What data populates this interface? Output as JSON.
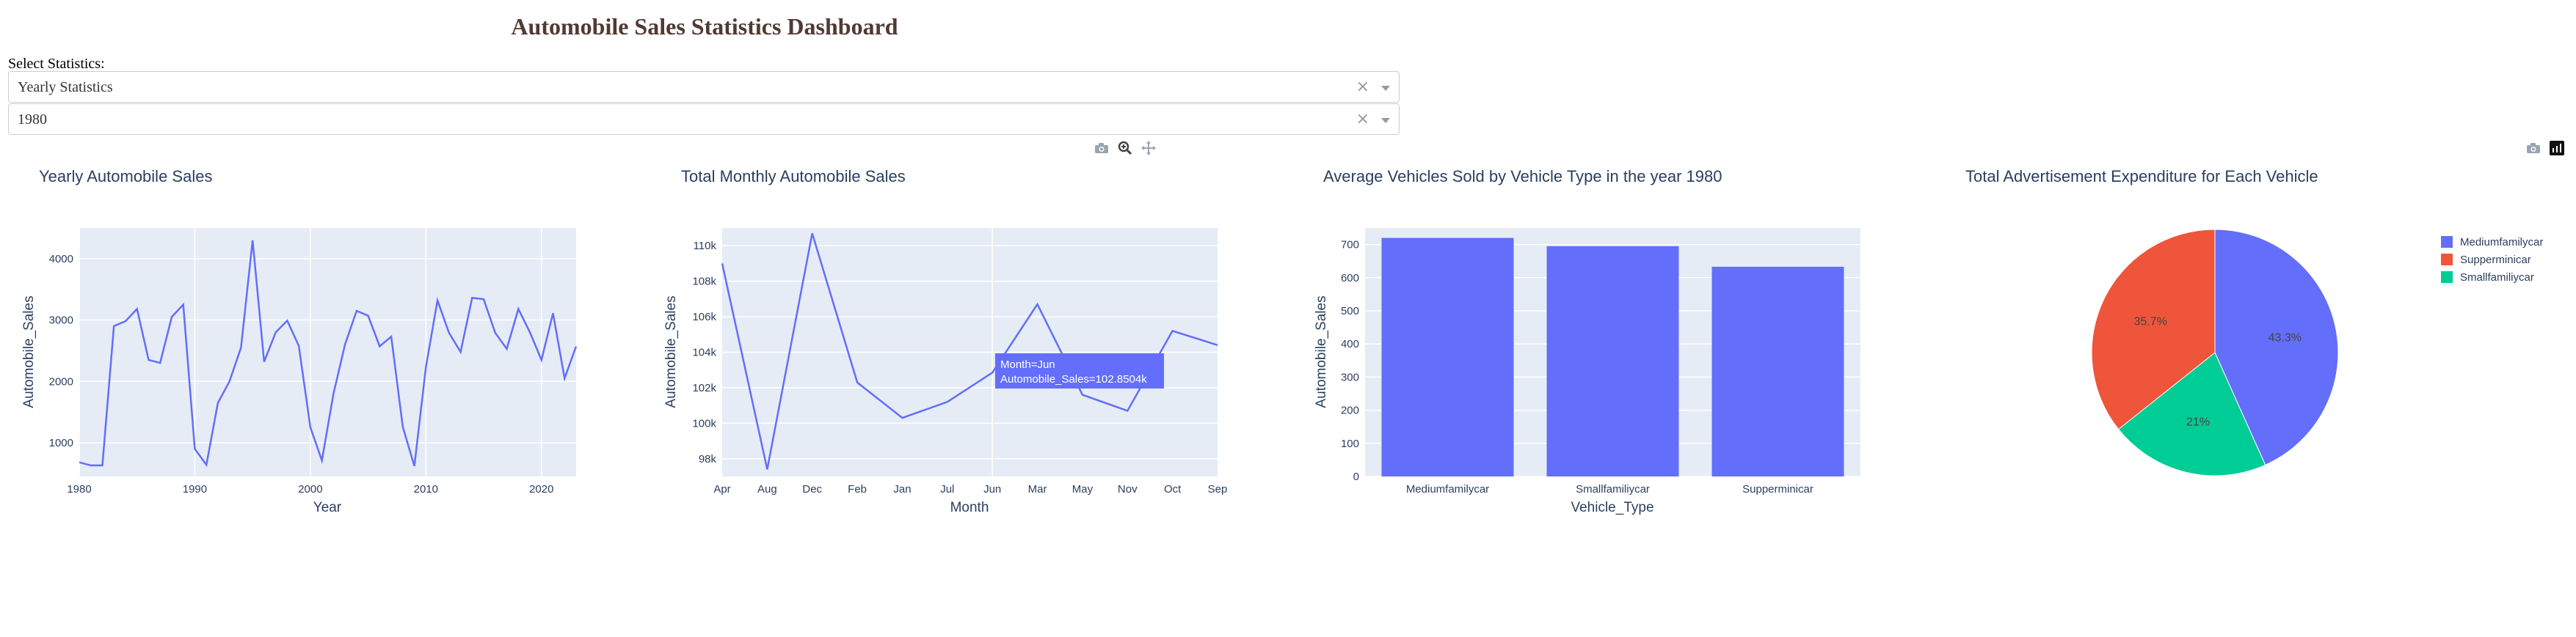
{
  "header": {
    "title": "Automobile Sales Statistics Dashboard"
  },
  "controls": {
    "label": "Select Statistics:",
    "dropdown1": {
      "value": "Yearly Statistics",
      "clear": "×"
    },
    "dropdown2": {
      "value": "1980",
      "clear": "×"
    }
  },
  "modebar1": [
    "camera-icon",
    "zoom-icon",
    "pan-icon"
  ],
  "modebar2": [
    "camera-icon",
    "plotly-logo-icon"
  ],
  "colors": {
    "series": "#636efa",
    "red": "#ef553b",
    "green": "#00cc96",
    "plot_bg": "#e5ecf6",
    "text": "#2a3f5f",
    "title": "#503a33"
  },
  "charts": [
    {
      "title": "Yearly Automobile Sales",
      "xlabel": "Year",
      "ylabel": "Automobile_Sales",
      "xticks": [
        "1980",
        "1990",
        "2000",
        "2010",
        "2020"
      ],
      "yticks": [
        "1000",
        "2000",
        "3000",
        "4000"
      ]
    },
    {
      "title": "Total Monthly Automobile Sales",
      "xlabel": "Month",
      "ylabel": "Automobile_Sales",
      "xticks": [
        "Apr",
        "Aug",
        "Dec",
        "Feb",
        "Jan",
        "Jul",
        "Jun",
        "Mar",
        "May",
        "Nov",
        "Oct",
        "Sep"
      ],
      "yticks": [
        "98k",
        "100k",
        "102k",
        "104k",
        "106k",
        "108k",
        "110k"
      ],
      "hover": {
        "line1": "Month=Jun",
        "line2": "Automobile_Sales=102.8504k"
      }
    },
    {
      "title": "Average Vehicles Sold by Vehicle Type in the year 1980",
      "xlabel": "Vehicle_Type",
      "ylabel": "Automobile_Sales",
      "xticks": [
        "Mediumfamilycar",
        "Smallfamiliycar",
        "Supperminicar"
      ],
      "yticks": [
        "0",
        "100",
        "200",
        "300",
        "400",
        "500",
        "600",
        "700"
      ]
    },
    {
      "title": "Total Advertisement Expenditure for Each Vehicle",
      "legend": [
        "Mediumfamilycar",
        "Supperminicar",
        "Smallfamiliycar"
      ],
      "labels": [
        "43.3%",
        "35.7%",
        "21%"
      ]
    }
  ],
  "chart_data": [
    {
      "type": "line",
      "x": [
        1980,
        1981,
        1982,
        1983,
        1984,
        1985,
        1986,
        1987,
        1988,
        1989,
        1990,
        1991,
        1992,
        1993,
        1994,
        1995,
        1996,
        1997,
        1998,
        1999,
        2000,
        2001,
        2002,
        2003,
        2004,
        2005,
        2006,
        2007,
        2008,
        2009,
        2010,
        2011,
        2012,
        2013,
        2014,
        2015,
        2016,
        2017,
        2018,
        2019,
        2020,
        2021,
        2022,
        2023
      ],
      "y": [
        680,
        630,
        630,
        2900,
        2980,
        3180,
        2350,
        2300,
        3050,
        3250,
        900,
        640,
        1650,
        2000,
        2550,
        4300,
        2320,
        2800,
        2990,
        2580,
        1250,
        710,
        1800,
        2600,
        3150,
        3070,
        2570,
        2730,
        1260,
        620,
        2230,
        3320,
        2790,
        2480,
        3360,
        3340,
        2790,
        2530,
        3180,
        2800,
        2350,
        3110,
        2050,
        2570
      ],
      "xlim": [
        1980,
        2023
      ],
      "ylim": [
        450,
        4500
      ]
    },
    {
      "type": "line",
      "categories": [
        "Apr",
        "Aug",
        "Dec",
        "Feb",
        "Jan",
        "Jul",
        "Jun",
        "Mar",
        "May",
        "Nov",
        "Oct",
        "Sep"
      ],
      "values": [
        109000,
        97400,
        110700,
        102300,
        100300,
        101200,
        102850,
        106700,
        101600,
        100700,
        105200,
        104400
      ],
      "ylim": [
        97000,
        111000
      ]
    },
    {
      "type": "bar",
      "categories": [
        "Mediumfamilycar",
        "Smallfamiliycar",
        "Supperminicar"
      ],
      "values": [
        720,
        695,
        633
      ],
      "ylim": [
        0,
        750
      ]
    },
    {
      "type": "pie",
      "labels": [
        "Mediumfamilycar",
        "Smallfamiliycar",
        "Supperminicar"
      ],
      "values": [
        43.3,
        21,
        35.7
      ]
    }
  ]
}
